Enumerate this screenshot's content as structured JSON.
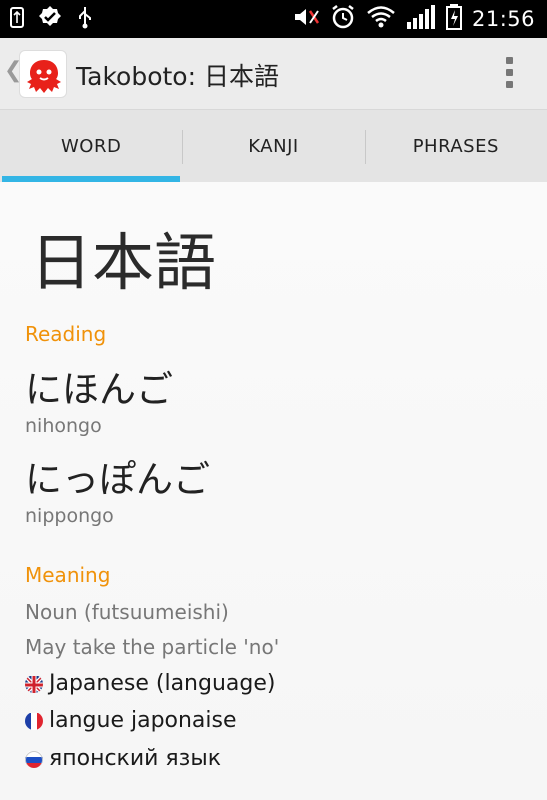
{
  "status_bar": {
    "time": "21:56",
    "left_icons": [
      "usb-icon",
      "check-badge-icon",
      "usb-debug-icon"
    ],
    "right_icons": [
      "mute-icon",
      "alarm-icon",
      "wifi-icon",
      "signal-icon",
      "battery-icon"
    ]
  },
  "app_bar": {
    "title": "Takoboto: 日本語",
    "app_icon": "octopus-icon",
    "overflow_icon": "overflow-menu-icon"
  },
  "tabs": [
    {
      "label": "WORD",
      "active": true
    },
    {
      "label": "KANJI",
      "active": false
    },
    {
      "label": "PHRASES",
      "active": false
    }
  ],
  "accent_colors": {
    "tab_indicator": "#33b5e5",
    "section_label": "#f0920a"
  },
  "entry": {
    "word": "日本語",
    "reading_label": "Reading",
    "readings": [
      {
        "kana": "にほんご",
        "romaji": "nihongo"
      },
      {
        "kana": "にっぽんご",
        "romaji": "nippongo"
      }
    ],
    "meaning_label": "Meaning",
    "pos": [
      "Noun (futsuumeishi)",
      "May take the particle 'no'"
    ],
    "glosses": [
      {
        "flag": "uk-flag-icon",
        "text": "Japanese (language)"
      },
      {
        "flag": "france-flag-icon",
        "text": "langue japonaise"
      },
      {
        "flag": "russia-flag-icon",
        "text": "японский язык"
      }
    ]
  }
}
